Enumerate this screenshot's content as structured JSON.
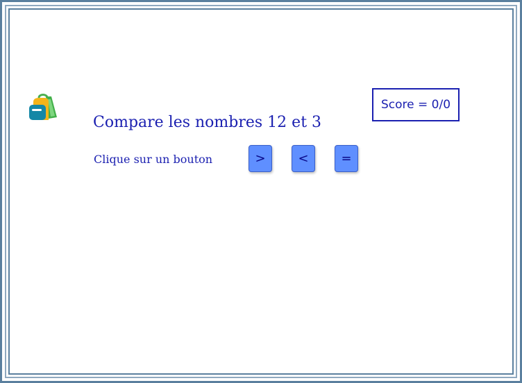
{
  "score": {
    "label": "Score = 0/0"
  },
  "question": {
    "text": "Compare les nombres 12 et 3"
  },
  "instruction": {
    "text": "Clique sur un bouton"
  },
  "buttons": {
    "greater": ">",
    "less": "<",
    "equal": "="
  },
  "icons": {
    "logo": "backpack-icon"
  },
  "colors": {
    "text": "#1a1fb0",
    "button": "#5f8fff",
    "frame": "#5a7f9e"
  }
}
